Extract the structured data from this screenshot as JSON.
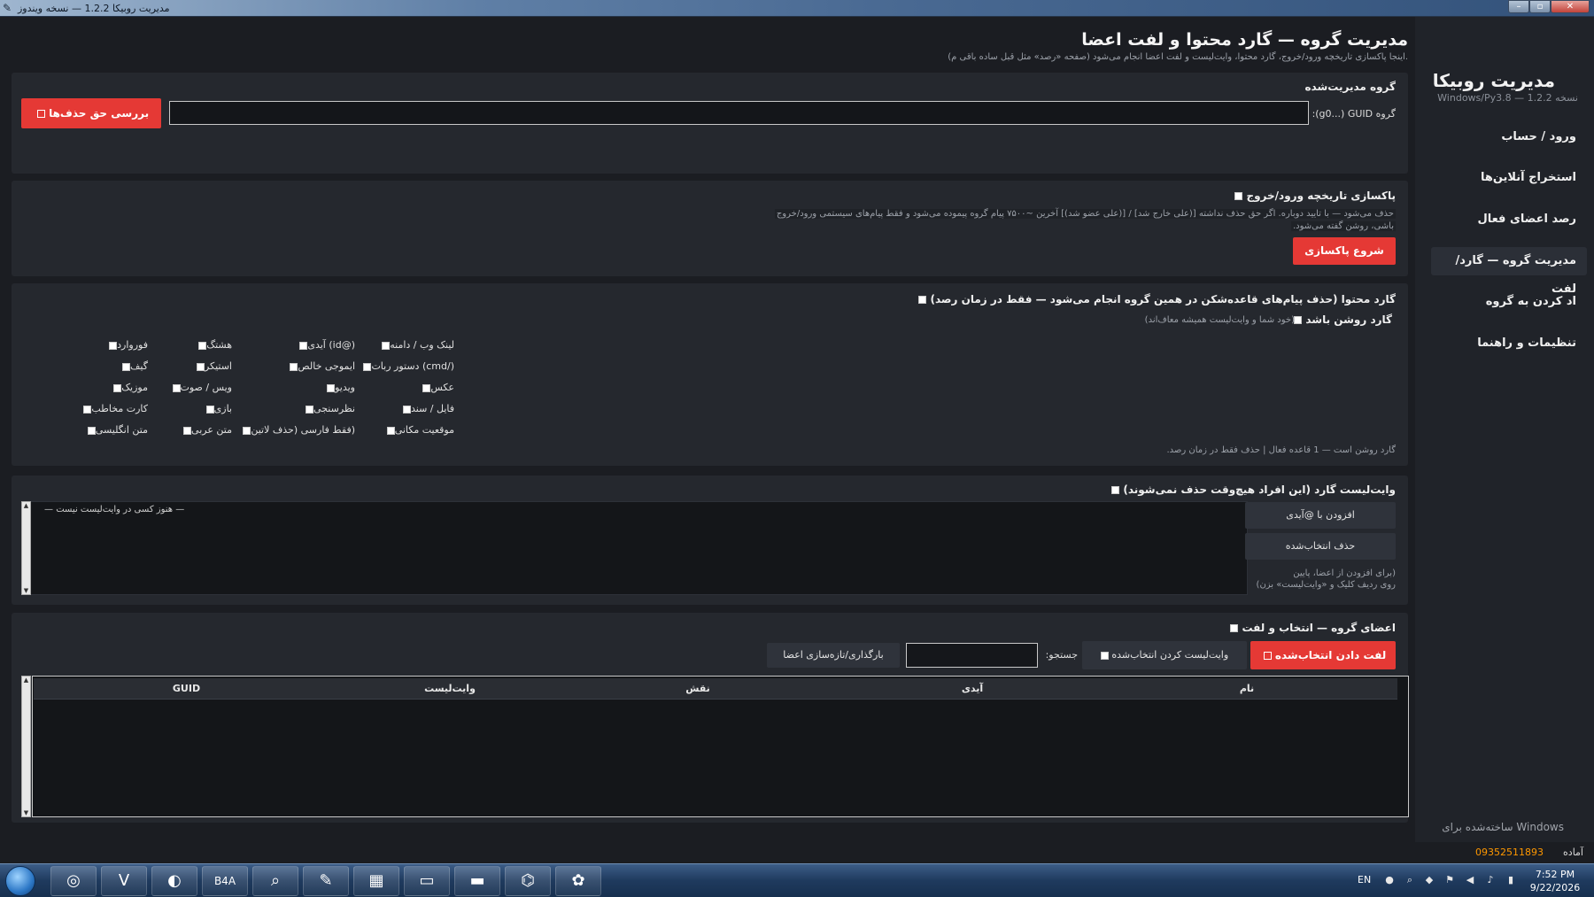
{
  "window": {
    "title": "مدیریت روبیکا 1.2.2 — نسخه ویندوز"
  },
  "sidebar": {
    "brand_title": "مدیریت روبیکا",
    "brand_sub": "Windows/Py3.8 — نسخه 1.2.2",
    "items": [
      {
        "label": "ورود / حساب"
      },
      {
        "label": "استخراج آنلاین‌ها"
      },
      {
        "label": "رصد اعضای فعال"
      },
      {
        "label": "مدیریت گروه — گارد/لفت"
      },
      {
        "label": "اد کردن به گروه"
      },
      {
        "label": "تنظیمات و راهنما"
      }
    ],
    "active_index": 3,
    "made_for": "ساخته‌شده برای Windows"
  },
  "header": {
    "title": "مدیریت گروه — گارد محتوا و لفت اعضا",
    "subtitle": "(اینجا پاکسازی تاریخچه ورود/خروج، گارد محتوا، وایت‌لیست و لفت اعضا انجام می‌شود (صفحه «رصد» مثل قبل ساده باقی م."
  },
  "group_section": {
    "title": "گروه مدیریت‌شده",
    "guid_label": ":(g0...) GUID گروه",
    "guid_value": "",
    "check_button": "بررسی حق حذف‌ها"
  },
  "cleanup_section": {
    "title": "پاکسازی تاریخچه ورود/خروج",
    "hint_line1": "حذف می‌شود — با تایید دوباره. اگر حق حذف نداشته [(علی خارج شد] / [(علی عضو شد)] آخرین ~۷۵۰۰ پیام گروه پیموده می‌شود و فقط پیام‌های سیستمی ورود/خروج",
    "hint_line2": ".باشی، روشن گفته می‌شود",
    "start_button": "شروع پاکسازی"
  },
  "guard_section": {
    "title": "(گارد محتوا (حذف پیام‌های قاعده‌شکن در همین گروه انجام می‌شود — فقط در زمان رصد",
    "enabled_label": "گارد روشن باشد",
    "enabled_hint": "(خود شما و وایت‌لیست همیشه معاف‌اند)",
    "filters": [
      {
        "label": "لینک وب / دامنه"
      },
      {
        "label": "(@id) آیدی"
      },
      {
        "label": "هشتگ"
      },
      {
        "label": "فوروارد"
      },
      {
        "label": "(/cmd) دستور ربات"
      },
      {
        "label": "ایموجی خالص"
      },
      {
        "label": "استیکر"
      },
      {
        "label": "گیف"
      },
      {
        "label": "عکس"
      },
      {
        "label": "ویدیو"
      },
      {
        "label": "ویس / صوت"
      },
      {
        "label": "موزیک"
      },
      {
        "label": "فایل / سند"
      },
      {
        "label": "نظرسنجی"
      },
      {
        "label": "بازی"
      },
      {
        "label": "کارت مخاطب"
      },
      {
        "label": "موقعیت مکانی"
      },
      {
        "label": "(فقط فارسی (حذف لاتین"
      },
      {
        "label": "متن عربی"
      },
      {
        "label": "متن انگلیسی"
      }
    ],
    "status": ".گارد روشن است — 1 قاعده فعال | حذف فقط در زمان رصد"
  },
  "whitelist_section": {
    "title": "(وایت‌لیست گارد (این افراد هیچ‌وقت حذف نمی‌شوند",
    "empty_text": "— هنوز کسی در وایت‌لیست نیست —",
    "add_button": "افزودن با @آیدی",
    "remove_button": "حذف انتخاب‌شده",
    "hint_line1": "برای افزودن از اعضا، پایین)",
    "hint_line2": "(روی ردیف کلیک و «وایت‌لیست» بزن"
  },
  "members_section": {
    "title": "اعضای گروه — انتخاب و لفت",
    "kick_button": "لفت دادن انتخاب‌شده",
    "whitelist_selected": "وایت‌لیست کردن انتخاب‌شده",
    "search_label": ":جستجو",
    "search_value": "",
    "reload_button": "بارگذاری/تازه‌سازی اعضا",
    "columns": [
      "نام",
      "آیدی",
      "نقش",
      "وایت‌لیست",
      "GUID"
    ]
  },
  "status_bar": {
    "status": "آماده",
    "phone": "09352511893"
  },
  "taskbar": {
    "apps": [
      "windows-orb",
      "chrome-icon",
      "v-app-icon",
      "paint-icon",
      "b4a-icon",
      "search-app-icon",
      "notepad-icon",
      "clapper-icon",
      "folder-icon",
      "terminal-icon",
      "python-icon",
      "palette-icon"
    ],
    "lang": "EN",
    "time": "7:52 PM",
    "date": "9/22/2026"
  },
  "colors": {
    "accent_red": "#e53935",
    "status_orange": "#ff9800",
    "bg": "#1b1d22",
    "panel": "#25282e"
  }
}
